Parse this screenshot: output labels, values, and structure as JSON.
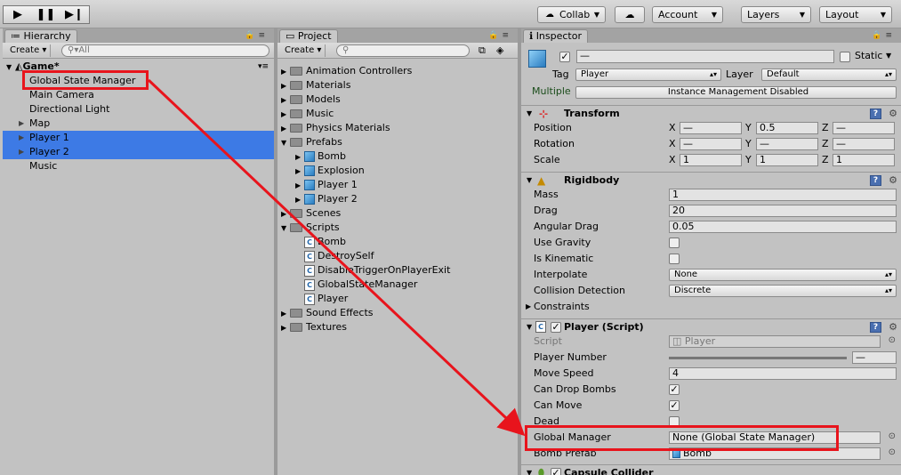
{
  "toolbar": {
    "collab": "Collab",
    "account": "Account",
    "layers": "Layers",
    "layout": "Layout"
  },
  "hierarchy": {
    "tab": "Hierarchy",
    "create": "Create",
    "search_placeholder": "All",
    "scene": "Game*",
    "items": [
      "Global State Manager",
      "Main Camera",
      "Directional Light",
      "Map",
      "Player 1",
      "Player 2",
      "Music"
    ]
  },
  "project": {
    "tab": "Project",
    "create": "Create",
    "items": [
      "Animation Controllers",
      "Materials",
      "Models",
      "Music",
      "Physics Materials",
      "Prefabs",
      "Bomb",
      "Explosion",
      "Player 1",
      "Player 2",
      "Scenes",
      "Scripts",
      "Bomb",
      "DestroySelf",
      "DisableTriggerOnPlayerExit",
      "GlobalStateManager",
      "Player",
      "Sound Effects",
      "Textures"
    ]
  },
  "inspector": {
    "tab": "Inspector",
    "name_value": "—",
    "static_label": "Static",
    "tag_label": "Tag",
    "tag_value": "Player",
    "layer_label": "Layer",
    "layer_value": "Default",
    "multiple_label": "Multiple",
    "multiple_value": "Instance Management Disabled",
    "transform": {
      "title": "Transform",
      "position_label": "Position",
      "rotation_label": "Rotation",
      "scale_label": "Scale",
      "x": "X",
      "y": "Y",
      "z": "Z",
      "pos_x": "—",
      "pos_y": "0.5",
      "pos_z": "—",
      "rot_x": "—",
      "rot_y": "—",
      "rot_z": "—",
      "scale_x": "1",
      "scale_y": "1",
      "scale_z": "1"
    },
    "rigidbody": {
      "title": "Rigidbody",
      "mass_label": "Mass",
      "mass": "1",
      "drag_label": "Drag",
      "drag": "20",
      "angular_drag_label": "Angular Drag",
      "angular_drag": "0.05",
      "use_gravity_label": "Use Gravity",
      "is_kinematic_label": "Is Kinematic",
      "interpolate_label": "Interpolate",
      "interpolate": "None",
      "collision_label": "Collision Detection",
      "collision": "Discrete",
      "constraints_label": "Constraints"
    },
    "player_script": {
      "title": "Player (Script)",
      "script_label": "Script",
      "script": "Player",
      "player_number_label": "Player Number",
      "player_number": "—",
      "move_speed_label": "Move Speed",
      "move_speed": "4",
      "can_drop_bombs_label": "Can Drop Bombs",
      "can_move_label": "Can Move",
      "dead_label": "Dead",
      "global_manager_label": "Global Manager",
      "global_manager": "None (Global State Manager)",
      "bomb_prefab_label": "Bomb Prefab",
      "bomb_prefab": "Bomb"
    },
    "capsule": {
      "title": "Capsule Collider"
    }
  },
  "colors": {
    "selection": "#3d7ae5",
    "highlight": "#e8141c"
  }
}
